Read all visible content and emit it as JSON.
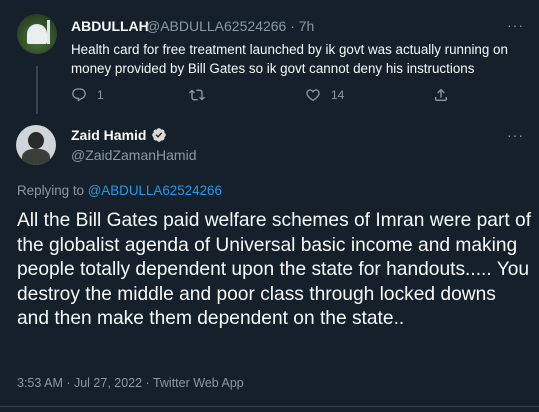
{
  "tweet1": {
    "name": "ABDULLAH",
    "handle_time": "@ABDULLA62524266 · 7h",
    "more": "···",
    "text": "Health card for free treatment launched by ik govt was actually running on money provided by Bill Gates so ik govt cannot deny his instructions",
    "reply_count": "1",
    "retweet_count": "",
    "like_count": "14"
  },
  "tweet2": {
    "name": "Zaid Hamid",
    "handle": "@ZaidZamanHamid",
    "more": "···",
    "replying_prefix": "Replying to ",
    "replying_handle": "@ABDULLA62524266",
    "text": "All the Bill Gates paid welfare schemes of Imran were part of the globalist agenda of Universal basic income and making people totally dependent upon the state for handouts..... You destroy the middle and poor class through locked downs and then make them dependent on the state..",
    "meta": "3:53 AM · Jul 27, 2022 · Twitter Web App"
  },
  "colors": {
    "background": "#15202b",
    "text": "#f7f9f9",
    "muted": "#8b98a5",
    "link": "#1d9bf0",
    "verified": "#1d9bf0"
  },
  "icons": [
    "reply-icon",
    "retweet-icon",
    "like-icon",
    "share-icon",
    "verified-badge-icon",
    "more-icon"
  ]
}
